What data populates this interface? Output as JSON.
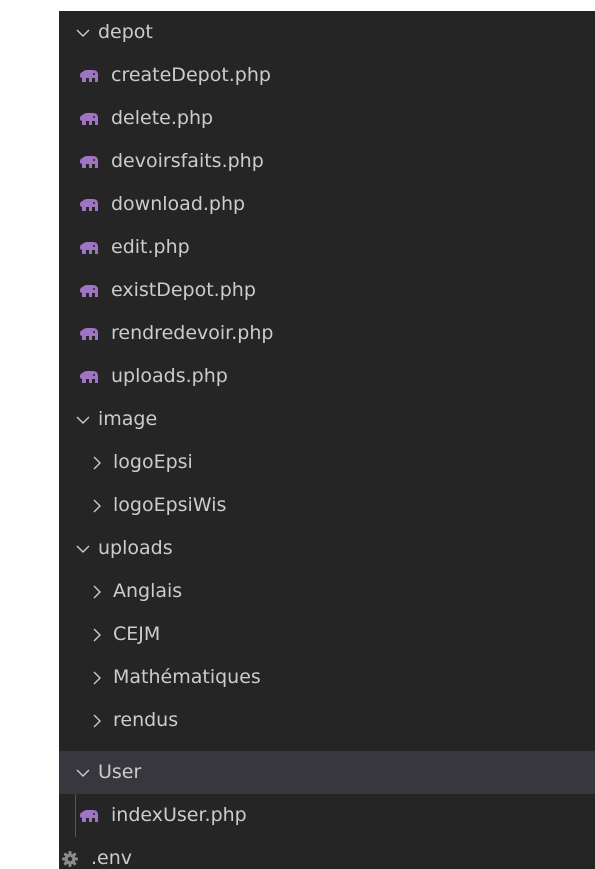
{
  "tree": {
    "rows": [
      {
        "label": "depot",
        "kind": "folder",
        "expanded": true,
        "depth": 0,
        "icon": "chevron-down-icon"
      },
      {
        "label": "createDepot.php",
        "kind": "file",
        "depth": 1,
        "icon": "php-elephant-icon"
      },
      {
        "label": "delete.php",
        "kind": "file",
        "depth": 1,
        "icon": "php-elephant-icon"
      },
      {
        "label": "devoirsfaits.php",
        "kind": "file",
        "depth": 1,
        "icon": "php-elephant-icon"
      },
      {
        "label": "download.php",
        "kind": "file",
        "depth": 1,
        "icon": "php-elephant-icon"
      },
      {
        "label": "edit.php",
        "kind": "file",
        "depth": 1,
        "icon": "php-elephant-icon"
      },
      {
        "label": "existDepot.php",
        "kind": "file",
        "depth": 1,
        "icon": "php-elephant-icon"
      },
      {
        "label": "rendredevoir.php",
        "kind": "file",
        "depth": 1,
        "icon": "php-elephant-icon"
      },
      {
        "label": "uploads.php",
        "kind": "file",
        "depth": 1,
        "icon": "php-elephant-icon"
      },
      {
        "label": "image",
        "kind": "folder",
        "expanded": true,
        "depth": 0,
        "icon": "chevron-down-icon"
      },
      {
        "label": "logoEpsi",
        "kind": "folder",
        "expanded": false,
        "depth": 1,
        "icon": "chevron-right-icon"
      },
      {
        "label": "logoEpsiWis",
        "kind": "folder",
        "expanded": false,
        "depth": 1,
        "icon": "chevron-right-icon"
      },
      {
        "label": "uploads",
        "kind": "folder",
        "expanded": true,
        "depth": 0,
        "icon": "chevron-down-icon"
      },
      {
        "label": "Anglais",
        "kind": "folder",
        "expanded": false,
        "depth": 1,
        "icon": "chevron-right-icon"
      },
      {
        "label": "CEJM",
        "kind": "folder",
        "expanded": false,
        "depth": 1,
        "icon": "chevron-right-icon"
      },
      {
        "label": "Mathématiques",
        "kind": "folder",
        "expanded": false,
        "depth": 1,
        "icon": "chevron-right-icon"
      },
      {
        "label": "rendus",
        "kind": "folder",
        "expanded": false,
        "depth": 1,
        "icon": "chevron-right-icon"
      },
      {
        "label": "User",
        "kind": "folder",
        "expanded": true,
        "depth": 0,
        "selected": true,
        "icon": "chevron-down-icon"
      },
      {
        "label": "indexUser.php",
        "kind": "file",
        "depth": 1,
        "icon": "php-elephant-icon"
      },
      {
        "label": ".env",
        "kind": "file",
        "depth": 0,
        "icon": "gear-icon"
      }
    ]
  },
  "colors": {
    "background": "#252526",
    "selected_row": "#37373d",
    "text": "#cccccc",
    "php_icon": "#a074c4",
    "gear_icon": "#8a8a8a",
    "indent_guide": "#585858"
  }
}
